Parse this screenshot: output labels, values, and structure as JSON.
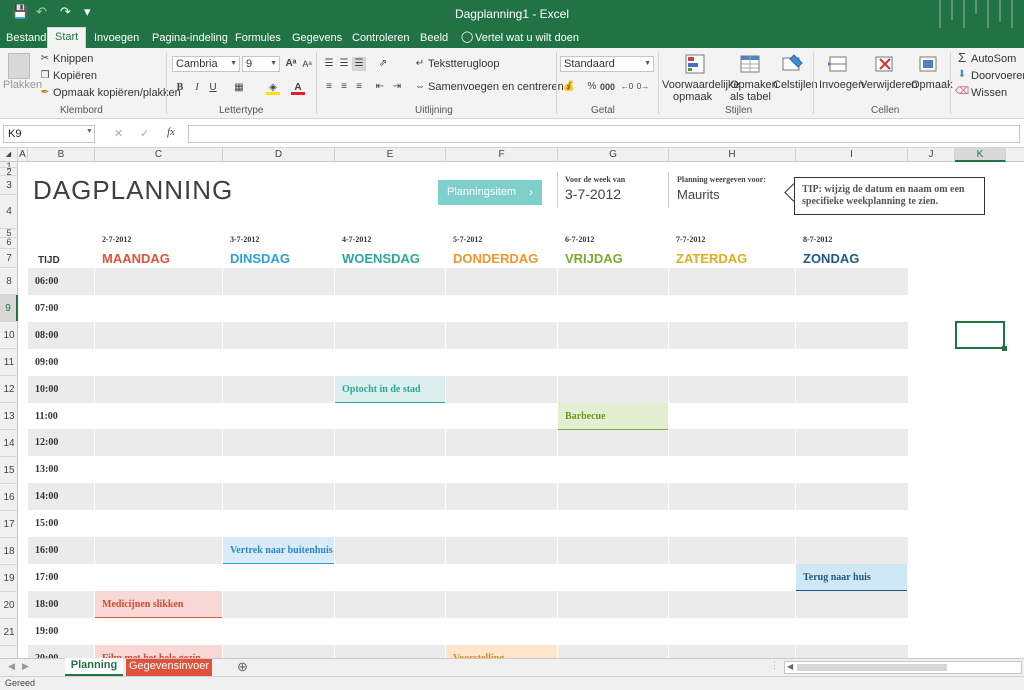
{
  "window": {
    "title": "Dagplanning1 - Excel"
  },
  "ribbon_tabs": [
    "Bestand",
    "Start",
    "Invoegen",
    "Pagina-indeling",
    "Formules",
    "Gegevens",
    "Controleren",
    "Beeld"
  ],
  "tell_me": "Vertel wat u wilt doen",
  "clipboard": {
    "paste": "Plakken",
    "cut": "Knippen",
    "copy": "Kopiëren",
    "format_painter": "Opmaak kopiëren/plakken",
    "group": "Klembord"
  },
  "font": {
    "name": "Cambria",
    "size": "9",
    "group": "Lettertype"
  },
  "alignment": {
    "wrap": "Tekstterugloop",
    "merge": "Samenvoegen en centreren",
    "group": "Uitlijning"
  },
  "number": {
    "format": "Standaard",
    "group": "Getal"
  },
  "styles": {
    "conditional_1": "Voorwaardelijke",
    "conditional_2": "opmaak",
    "format_table_1": "Opmaken",
    "format_table_2": "als tabel",
    "cell_styles": "Celstijlen",
    "group": "Stijlen"
  },
  "cells": {
    "insert": "Invoegen",
    "delete": "Verwijderen",
    "format": "Opmaak",
    "group": "Cellen"
  },
  "editing": {
    "autosum": "AutoSom",
    "fill": "Doorvoeren",
    "clear": "Wissen"
  },
  "formula_bar": {
    "name_box": "K9",
    "fx": "fx",
    "content": ""
  },
  "columns": [
    "A",
    "B",
    "C",
    "D",
    "E",
    "F",
    "G",
    "H",
    "I",
    "J",
    "K"
  ],
  "rows": [
    "1",
    "2",
    "3",
    "4",
    "5",
    "6",
    "7",
    "8",
    "9",
    "10",
    "11",
    "12",
    "13",
    "14",
    "15",
    "16",
    "17",
    "18",
    "19",
    "20",
    "21"
  ],
  "sheet": {
    "title": "DAGPLANNING",
    "planning_button": "Planningsitem",
    "week_label": "Voor de week van",
    "week_value": "3-7-2012",
    "person_label": "Planning weergeven voor:",
    "person_value": "Maurits",
    "tip": "TIP: wijzig de datum en naam om een specifieke weekplanning te zien.",
    "time_header": "TIJD",
    "days": [
      {
        "date": "2-7-2012",
        "name": "MAANDAG",
        "color": "#e0533a"
      },
      {
        "date": "3-7-2012",
        "name": "DINSDAG",
        "color": "#2e9fd8"
      },
      {
        "date": "4-7-2012",
        "name": "WOENSDAG",
        "color": "#2ba89b"
      },
      {
        "date": "5-7-2012",
        "name": "DONDERDAG",
        "color": "#f0962f"
      },
      {
        "date": "6-7-2012",
        "name": "VRIJDAG",
        "color": "#7cab2e"
      },
      {
        "date": "7-7-2012",
        "name": "ZATERDAG",
        "color": "#e3ad1c"
      },
      {
        "date": "8-7-2012",
        "name": "ZONDAG",
        "color": "#1f5a86"
      }
    ],
    "times": [
      "06:00",
      "07:00",
      "08:00",
      "09:00",
      "10:00",
      "11:00",
      "12:00",
      "13:00",
      "14:00",
      "15:00",
      "16:00",
      "17:00",
      "18:00",
      "19:00",
      "20:00"
    ],
    "events": [
      {
        "day": 2,
        "time": 4,
        "text": "Optocht in de stad",
        "bg": "#dcefee",
        "border": "#2ba89b",
        "color": "#2ba89b"
      },
      {
        "day": 4,
        "time": 5,
        "text": "Barbecue",
        "bg": "#e3efd0",
        "border": "#7cab2e",
        "color": "#6a9a22"
      },
      {
        "day": 1,
        "time": 10,
        "text": "Vertrek naar buitenhuis",
        "bg": "#d7ecf8",
        "border": "#2e9fd8",
        "color": "#2e88c0"
      },
      {
        "day": 6,
        "time": 11,
        "text": "Terug naar huis",
        "bg": "#d0e8f5",
        "border": "#1f5a86",
        "color": "#1f5a86"
      },
      {
        "day": 0,
        "time": 12,
        "text": "Medicijnen slikken",
        "bg": "#f8d8d4",
        "border": "#e0533a",
        "color": "#d6492f"
      },
      {
        "day": 0,
        "time": 14,
        "text": "Film met het hele gezin",
        "bg": "#f8d8d4",
        "border": "#e0533a",
        "color": "#d6492f"
      },
      {
        "day": 3,
        "time": 14,
        "text": "Voorstelling",
        "bg": "#fde6cc",
        "border": "#f0962f",
        "color": "#e08a20"
      }
    ]
  },
  "sheet_tabs": [
    {
      "label": "Planning",
      "active": true
    },
    {
      "label": "Gegevensinvoer",
      "active": false
    }
  ],
  "status": "Gereed"
}
